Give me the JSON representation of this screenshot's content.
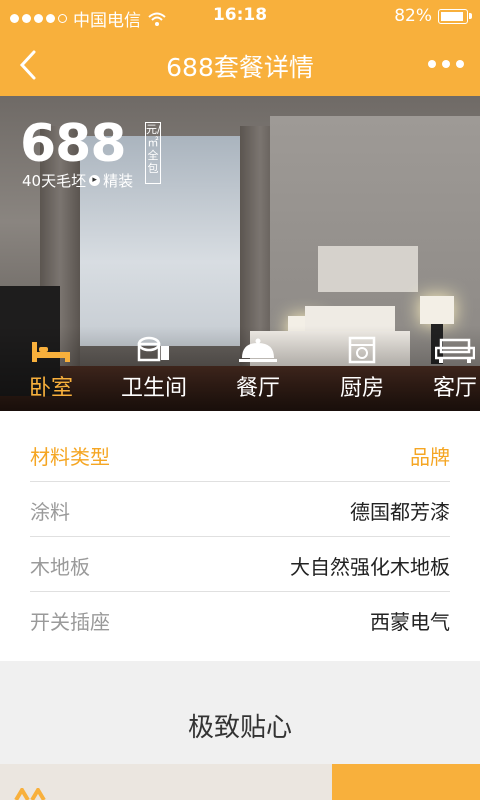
{
  "status_bar": {
    "carrier": "中国电信",
    "time": "16:18",
    "battery": "82%",
    "battery_level": 0.82
  },
  "nav": {
    "title": "688套餐详情"
  },
  "hero": {
    "price": "688",
    "unit_vertical": "元/㎡全包",
    "tagline_from": "40天毛坯",
    "tagline_to": "精装"
  },
  "categories": [
    {
      "label": "卧室",
      "icon": "bed-icon"
    },
    {
      "label": "卫生间",
      "icon": "toilet-icon"
    },
    {
      "label": "餐厅",
      "icon": "dining-cloche-icon"
    },
    {
      "label": "厨房",
      "icon": "stove-icon"
    },
    {
      "label": "客厅",
      "icon": "sofa-icon"
    }
  ],
  "active_category": "卧室",
  "materials": {
    "header": {
      "type": "材料类型",
      "brand": "品牌"
    },
    "rows": [
      {
        "type": "涂料",
        "brand": "德国都芳漆"
      },
      {
        "type": "木地板",
        "brand": "大自然强化木地板"
      },
      {
        "type": "开关插座",
        "brand": "西蒙电气"
      }
    ]
  },
  "section": {
    "title": "极致贴心"
  },
  "colors": {
    "accent": "#f8b03c",
    "header_text": "#f5a623"
  }
}
